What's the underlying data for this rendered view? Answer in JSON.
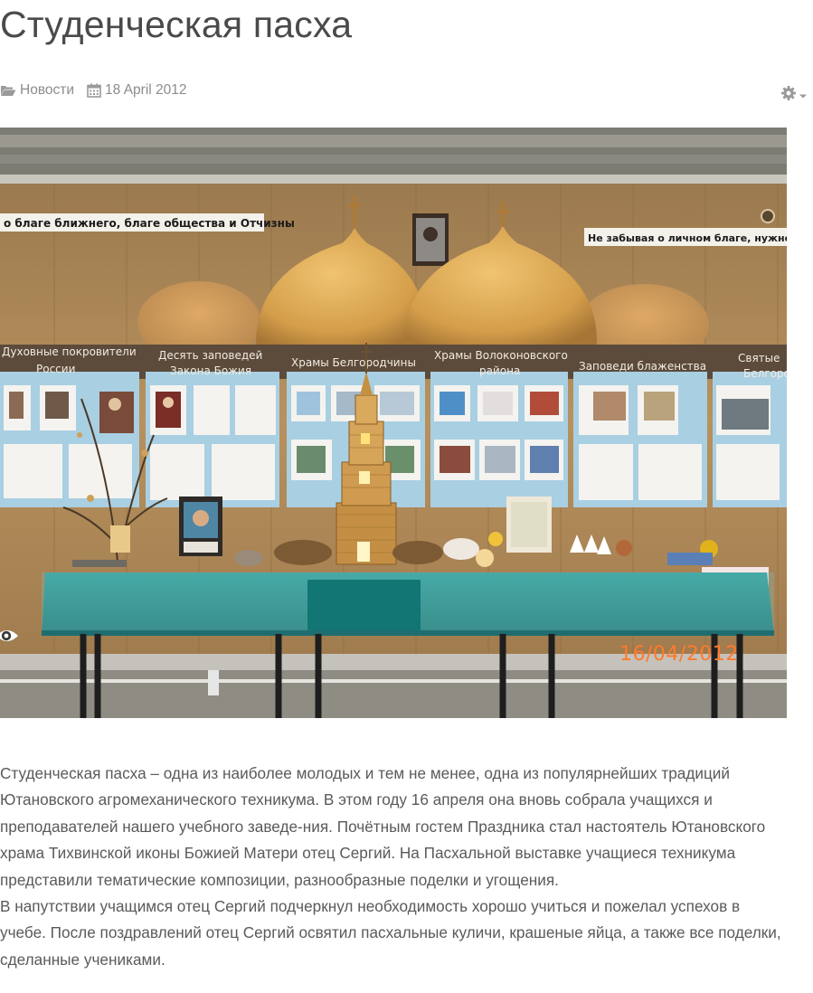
{
  "article": {
    "title": "Студенческая пасха",
    "category": "Новости",
    "date": "18 April 2012",
    "icons": {
      "category": "folder-open-icon",
      "date": "calendar-icon",
      "tools": "gear-icon",
      "tools_caret": "caret-down-icon",
      "image_overlay": "eye-icon"
    },
    "photo": {
      "date_stamp": "16/04/2012",
      "banner_left": "о благе ближнего, благе общества и Отчизны",
      "banner_right": "Не забывая о личном благе, нужно помнить",
      "boards": [
        {
          "l1": "Духовные покровители",
          "l2": "России"
        },
        {
          "l1": "Десять заповедей",
          "l2": "Закона Божия"
        },
        {
          "l1": "Храмы Белгородчины",
          "l2": ""
        },
        {
          "l1": "Храмы Волоконовского",
          "l2": "района"
        },
        {
          "l1": "Заповеди блаженства",
          "l2": ""
        },
        {
          "l1": "Святые",
          "l2": "Белгоро"
        }
      ]
    },
    "body_lines": [
      "Студенческая пасха – одна из наиболее молодых и тем не менее, одна из популярнейших традиций",
      "Ютановского агромеханического техникума. В этом году 16 апреля она вновь собрала учащихся и",
      "преподавателей нашего учебного заведе-ния. Почётным гостем Праздника стал настоятель Ютановского",
      "храма Тихвинской иконы Божией Матери отец Сергий. На Пасхальной выставке учащиеся техникума",
      "представили тематические композиции, разнообразные поделки и угощения.",
      "В напутствии учащимся отец Сергий подчеркнул необходимость хорошо учиться и пожелал успехов в",
      "учебе. После поздравлений отец Сергий освятил пасхальные куличи, крашеные яйца, а также все поделки,",
      "сделанные учениками."
    ],
    "colors": {
      "meta": "#8c8c8c",
      "date_stamp": "#ff7a2c",
      "wall": "#b08a58",
      "boards": "#a9cfe3",
      "tablecloth": "#1d8c8a"
    }
  }
}
